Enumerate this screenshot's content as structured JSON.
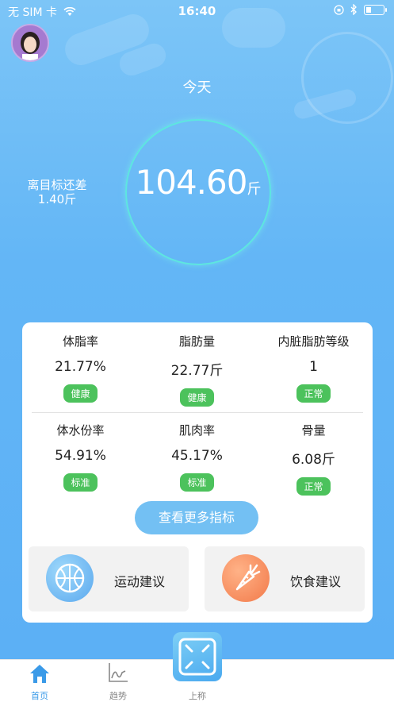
{
  "status_bar": {
    "carrier": "无 SIM 卡",
    "time": "16:40"
  },
  "header": {
    "today_label": "今天",
    "goal_line1": "离目标还差",
    "goal_line2": "1.40斤",
    "weight_value": "104.60",
    "weight_unit": "斤"
  },
  "metrics": [
    {
      "label": "体脂率",
      "value": "21.77%",
      "badge": "健康"
    },
    {
      "label": "脂肪量",
      "value": "22.77斤",
      "badge": "健康"
    },
    {
      "label": "内脏脂肪等级",
      "value": "1",
      "badge": "正常"
    },
    {
      "label": "体水份率",
      "value": "54.91%",
      "badge": "标准"
    },
    {
      "label": "肌肉率",
      "value": "45.17%",
      "badge": "标准"
    },
    {
      "label": "骨量",
      "value": "6.08斤",
      "badge": "正常"
    }
  ],
  "more_button": "查看更多指标",
  "advice": {
    "exercise": "运动建议",
    "diet": "饮食建议"
  },
  "tabs": {
    "home": "首页",
    "trend": "趋势",
    "weigh": "上称"
  },
  "colors": {
    "accent_blue": "#5cb0f5",
    "badge_green": "#4cc25c",
    "active_tab": "#3a9ae8"
  }
}
